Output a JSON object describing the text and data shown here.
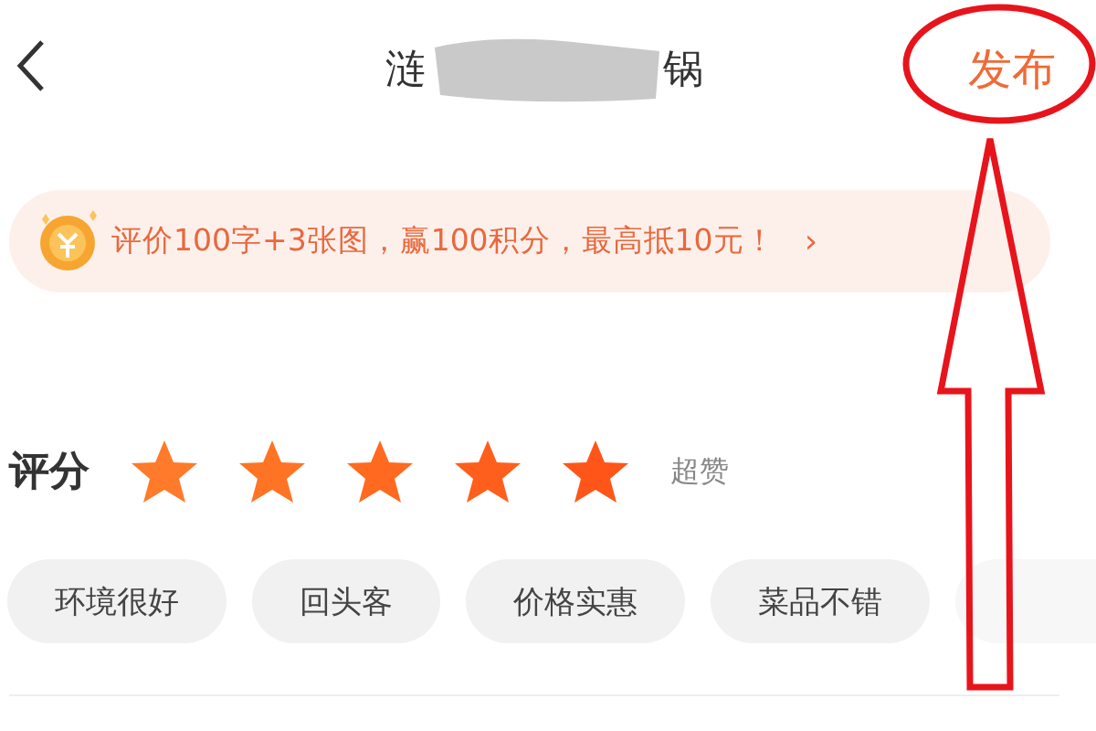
{
  "header": {
    "title_start": "涟",
    "title_end": "锅",
    "publish": "发布"
  },
  "banner": {
    "text": "评价100字+3张图，赢100积分，最高抵10元！",
    "chevron": "›"
  },
  "rating": {
    "label": "评分",
    "stars": 5,
    "caption": "超赞"
  },
  "tags": [
    "环境很好",
    "回头客",
    "价格实惠",
    "菜品不错"
  ]
}
